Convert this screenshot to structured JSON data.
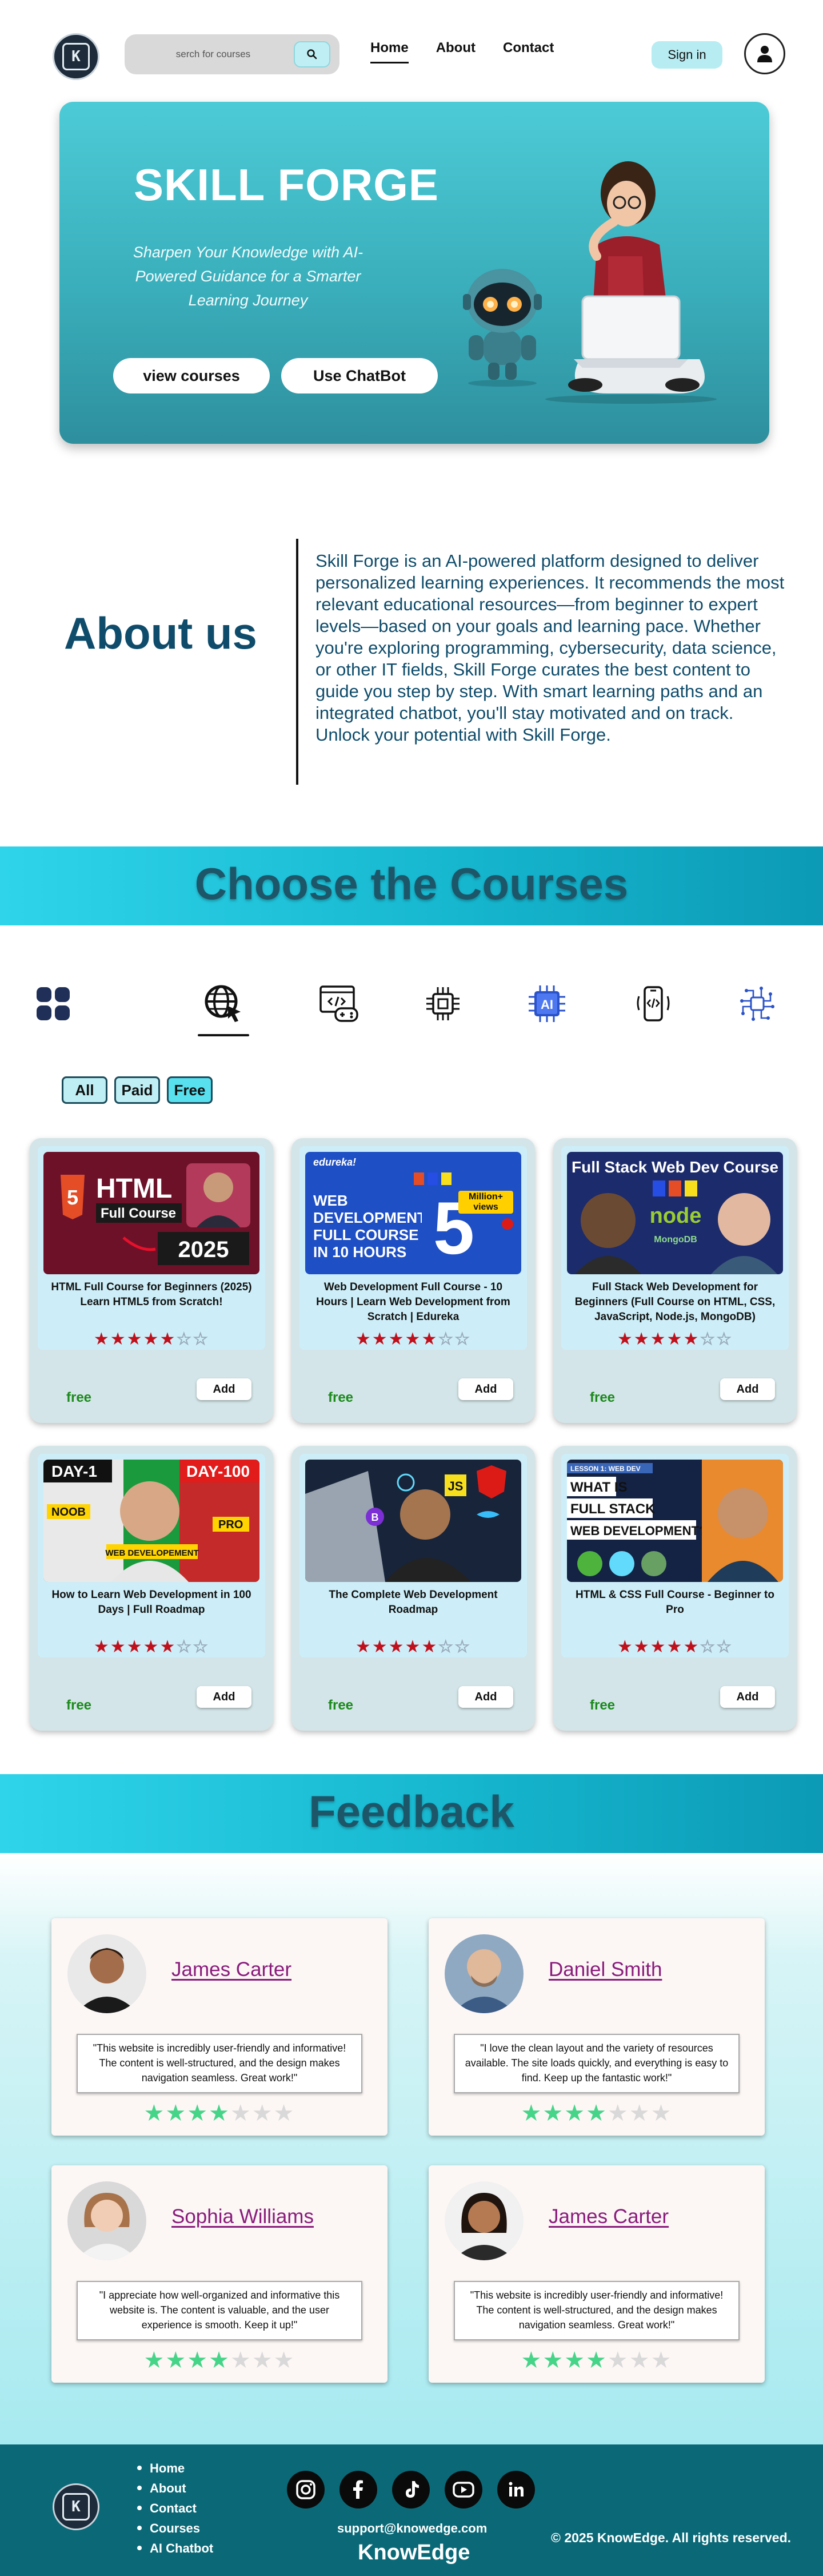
{
  "nav": {
    "search_placeholder": "serch for courses",
    "links": [
      "Home",
      "About",
      "Contact"
    ],
    "signin_label": "Sign in"
  },
  "hero": {
    "title": "SKILL FORGE",
    "tagline": "Sharpen Your Knowledge with AI-Powered Guidance for a Smarter Learning Journey",
    "view_courses_label": "view courses",
    "chatbot_label": "Use ChatBot"
  },
  "about": {
    "title": "About us",
    "text": "Skill Forge is an AI-powered platform designed to deliver personalized learning experiences. It recommends the most relevant educational resources—from beginner to expert levels—based on your goals and learning pace. Whether you're exploring programming, cybersecurity, data science, or other IT fields, Skill Forge curates the best content to guide you step by step. With smart learning paths and an integrated chatbot, you'll stay motivated and on track.  Unlock your potential with Skill Forge."
  },
  "courses_section": {
    "title": "Choose the Courses",
    "categories": [
      "grid-icon",
      "web-globe-icon",
      "game-dev-icon",
      "chip-icon",
      "ai-icon",
      "mobile-dev-icon",
      "circuit-icon"
    ],
    "filters": [
      "All",
      "Paid",
      "Free"
    ]
  },
  "courses": [
    {
      "title": "HTML Full Course for Beginners (2025) Learn HTML5 from Scratch!",
      "price": "free",
      "rating": 5,
      "add_label": "Add",
      "thumb": {
        "lines": [
          "HTML",
          "Full Course",
          "2025"
        ],
        "bg": "#7a1230"
      }
    },
    {
      "title": "Web Development Full Course - 10 Hours | Learn Web Development from Scratch | Edureka",
      "price": "free",
      "rating": 5,
      "add_label": "Add",
      "thumb": {
        "lines": [
          "edureka!",
          "WEB DEVELOPMENT FULL COURSE IN 10 HOURS",
          "5",
          "Million+ views"
        ],
        "bg": "#1d4fc4"
      }
    },
    {
      "title": "Full Stack Web Development for Beginners (Full Course on HTML, CSS, JavaScript, Node.js, MongoDB)",
      "price": "free",
      "rating": 5,
      "add_label": "Add",
      "thumb": {
        "lines": [
          "Full Stack Web Dev Course"
        ],
        "bg": "#1c2a6a"
      }
    },
    {
      "title": "How to Learn Web Development in 100 Days | Full Roadmap",
      "price": "free",
      "rating": 5,
      "add_label": "Add",
      "thumb": {
        "lines": [
          "DAY-1",
          "DAY-100",
          "NOOB",
          "PRO",
          "WEB DEVELOPEMENT"
        ],
        "bg": "#1a8f3a"
      }
    },
    {
      "title": "The Complete Web Development Roadmap",
      "price": "free",
      "rating": 5,
      "add_label": "Add",
      "thumb": {
        "lines": [
          "JS"
        ],
        "bg": "#18243a"
      }
    },
    {
      "title": "HTML & CSS Full Course - Beginner to Pro",
      "price": "free",
      "rating": 5,
      "add_label": "Add",
      "thumb": {
        "lines": [
          "LESSON 1: WEB DEV",
          "WHAT IS",
          "FULL STACK",
          "WEB DEVELOPMENT?"
        ],
        "bg": "#142244"
      }
    }
  ],
  "feedback": {
    "title": "Feedback",
    "items": [
      {
        "name": "James Carter",
        "quote": "\"This website is incredibly user-friendly and informative! The content is well-structured, and the design makes navigation seamless. Great work!\"",
        "rating": 4
      },
      {
        "name": "Daniel Smith",
        "quote": "\"I love the clean layout and the variety of resources available. The site loads quickly, and everything is easy to find. Keep up the fantastic work!\"",
        "rating": 4
      },
      {
        "name": "Sophia Williams",
        "quote": "\"I appreciate how well-organized and informative this website is. The content is valuable, and the user experience is smooth. Keep it up!\"",
        "rating": 4
      },
      {
        "name": "James Carter",
        "quote": "\"This website is incredibly user-friendly and informative! The content is well-structured, and the design makes navigation seamless. Great work!\"",
        "rating": 4
      }
    ]
  },
  "footer": {
    "links": [
      "Home",
      "About",
      "Contact",
      "Courses",
      "AI Chatbot"
    ],
    "socials": [
      "instagram-icon",
      "facebook-icon",
      "tiktok-icon",
      "youtube-icon",
      "linkedin-icon"
    ],
    "email": "support@knowedge.com",
    "brand": "KnowEdge",
    "copyright": "© 2025 KnowEdge. All rights reserved."
  },
  "colors": {
    "accent": "#1fc3dc",
    "dark_teal": "#0b6977",
    "heading": "#0f4c6b",
    "star_red": "#c0101c",
    "star_green": "#46d488",
    "free_green": "#1c8a1c"
  }
}
